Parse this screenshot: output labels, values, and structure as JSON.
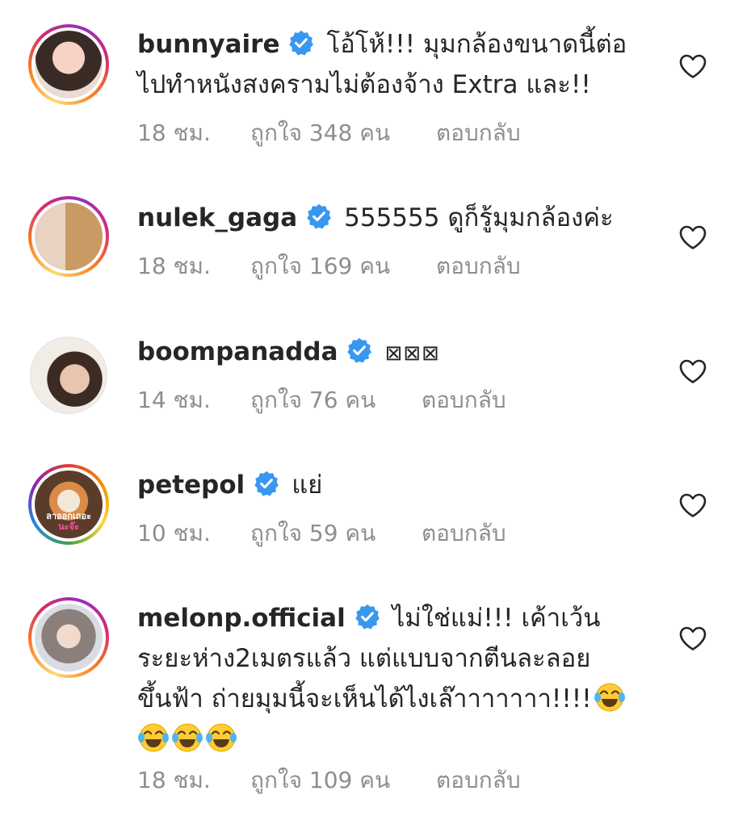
{
  "comments": [
    {
      "username": "bunnyaire",
      "lines": [
        "โอ้โห้!!! มุมกล้องขนาดนี้ต่อ",
        "ไปทำหนังสงครามไม่ต้องจ้าง Extra และ!!"
      ],
      "time": "18 ชม.",
      "likes": "ถูกใจ 348 คน",
      "reply": "ตอบกลับ"
    },
    {
      "username": "nulek_gaga",
      "lines": [
        "555555 ดูก็รู้มุมกล้องค่ะ"
      ],
      "time": "18 ชม.",
      "likes": "ถูกใจ 169 คน",
      "reply": "ตอบกลับ"
    },
    {
      "username": "boompanadda",
      "lines": [
        "⊠⊠⊠"
      ],
      "time": "14 ชม.",
      "likes": "ถูกใจ 76 คน",
      "reply": "ตอบกลับ"
    },
    {
      "username": "petepol",
      "avatar_text": [
        "ลาออกเถอะ",
        "นะจ๊ะ"
      ],
      "lines": [
        "แย่"
      ],
      "time": "10 ชม.",
      "likes": "ถูกใจ 59 คน",
      "reply": "ตอบกลับ"
    },
    {
      "username": "melonp.official",
      "lines": [
        "ไม่ใช่แม่!!! เค้าเว้น",
        "ระยะห่าง2เมตรแล้ว แต่แบบจากตีนละลอย",
        "ขึ้นฟ้า ถ่ายมุมนี้จะเห็นได้ไงเล๊าาาาาาา!!!!"
      ],
      "time": "18 ชม.",
      "likes": "ถูกใจ 109 คน",
      "reply": "ตอบกลับ"
    }
  ],
  "icons": {
    "verified": "verified-badge-icon",
    "like": "heart-outline-icon",
    "emoji": "face-with-tears-of-joy-icon"
  },
  "colors": {
    "verified_blue": "#3897f0",
    "meta_gray": "#8e8e8e",
    "text": "#262626"
  }
}
